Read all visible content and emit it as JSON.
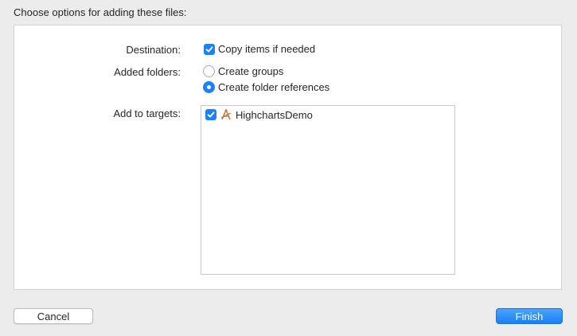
{
  "dialog": {
    "title": "Choose options for adding these files:"
  },
  "destination": {
    "label": "Destination:",
    "option_label": "Copy items if needed",
    "checked": true
  },
  "added_folders": {
    "label": "Added folders:",
    "options": [
      {
        "label": "Create groups",
        "selected": false
      },
      {
        "label": "Create folder references",
        "selected": true
      }
    ]
  },
  "targets": {
    "label": "Add to targets:",
    "items": [
      {
        "name": "HighchartsDemo",
        "checked": true,
        "icon": "app-target-icon"
      }
    ]
  },
  "buttons": {
    "cancel_label": "Cancel",
    "finish_label": "Finish"
  },
  "colors": {
    "accent": "#1a82fb",
    "background": "#ececec",
    "panel": "#ffffff"
  }
}
